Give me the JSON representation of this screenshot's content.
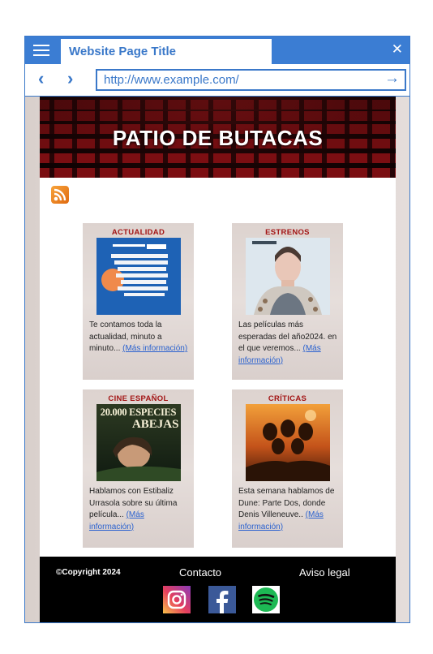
{
  "browser": {
    "tab_title": "Website Page Title",
    "url": "http://www.example.com/",
    "icons": [
      "menu-icon",
      "close-icon",
      "back-icon",
      "forward-icon",
      "go-arrow-icon"
    ]
  },
  "site": {
    "banner_title": "PATIO DE BUTACAS",
    "rss_icon": "rss-icon"
  },
  "cards": [
    {
      "category": "ACTUALIDAD",
      "text": "Te contamos toda la actualidad, minuto a minuto... ",
      "link": "(Más información)"
    },
    {
      "category": "ESTRENOS",
      "text": "Las películas más esperadas del año2024. en el que veremos... ",
      "link": "(Más información)"
    },
    {
      "category": "CINE ESPAÑOL",
      "poster_title_line1": "20.000 ESPECIES",
      "poster_title_line2": "ABEJAS",
      "text": "Hablamos con Estibaliz Urrasola sobre su última película... ",
      "link": "(Más información)"
    },
    {
      "category": "CRÍTICAS",
      "text": "Esta semana hablamos de Dune: Parte Dos, donde Denis Villeneuve.. ",
      "link": "(Más información)"
    }
  ],
  "footer": {
    "copyright": "©Copyright 2024",
    "contact": "Contacto",
    "legal": "Aviso legal",
    "social_icons": [
      "instagram-icon",
      "facebook-icon",
      "spotify-icon"
    ]
  },
  "colors": {
    "browser_accent": "#3b7dd3",
    "category_red": "#a31515",
    "link_blue": "#2b62cf",
    "footer_bg": "#000000"
  }
}
